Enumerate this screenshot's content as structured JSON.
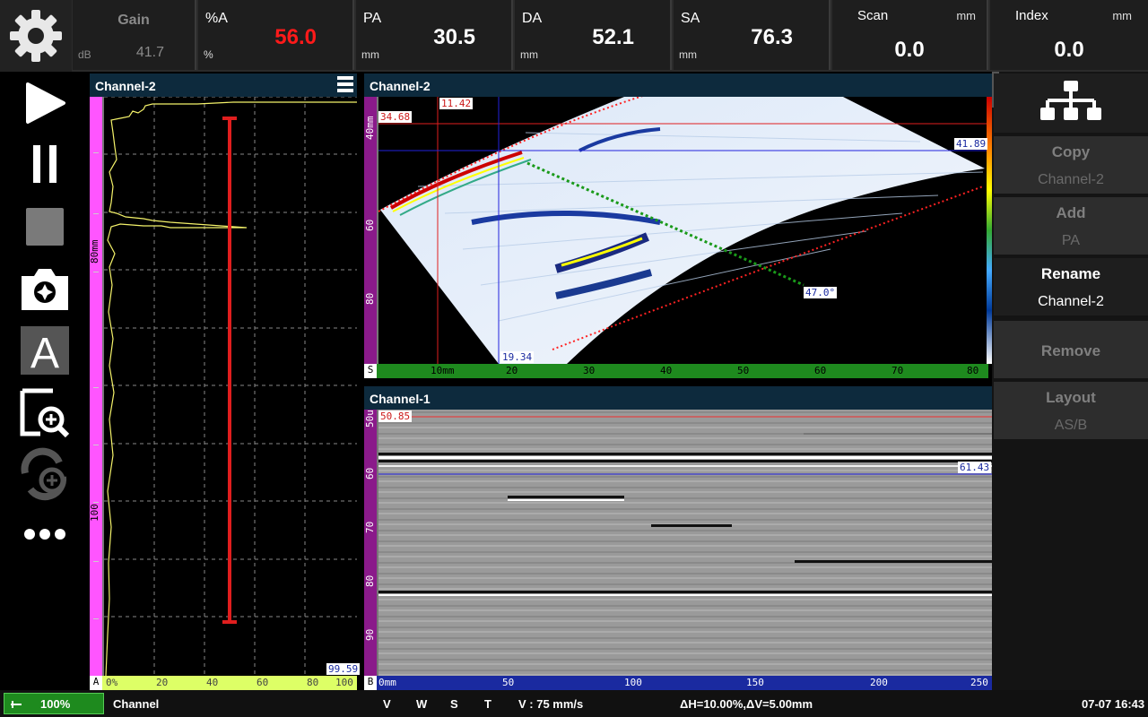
{
  "topbar": {
    "gain": {
      "label": "Gain",
      "unit": "dB",
      "value": "41.7"
    },
    "pct_a": {
      "label": "%A",
      "unit": "%",
      "value": "56.0"
    },
    "pa": {
      "label": "PA",
      "unit": "mm",
      "value": "30.5"
    },
    "da": {
      "label": "DA",
      "unit": "mm",
      "value": "52.1"
    },
    "sa": {
      "label": "SA",
      "unit": "mm",
      "value": "76.3"
    },
    "scan": {
      "label": "Scan",
      "unit": "mm",
      "value": "0.0"
    },
    "index": {
      "label": "Index",
      "unit": "mm",
      "value": "0.0"
    }
  },
  "left_tools": [
    "gear-icon",
    "play-icon",
    "pause-icon",
    "stop-icon",
    "camera-icon",
    "text-annotation-icon",
    "zoom-icon",
    "rotate-zoom-icon",
    "more-icon"
  ],
  "ascan": {
    "title": "Channel-2",
    "ruler_letter": "A",
    "depth_labels": [
      "80mm",
      "100"
    ],
    "x_ticks": [
      "0%",
      "20",
      "40",
      "60",
      "80",
      "100"
    ],
    "cursor_value": "99.59"
  },
  "sscan": {
    "title": "Channel-2",
    "ruler_letter": "S",
    "depth_labels": [
      "40mm",
      "60",
      "80"
    ],
    "x_ticks": [
      "10mm",
      "20",
      "30",
      "40",
      "50",
      "60",
      "70",
      "80"
    ],
    "ref_h": "34.68",
    "ref_v": "11.42",
    "meas_h": "41.89",
    "meas_v": "19.34",
    "angle": "47.0°"
  },
  "bscan": {
    "title": "Channel-1",
    "ruler_letter": "B",
    "depth_labels": [
      "50us",
      "60",
      "70",
      "80",
      "90"
    ],
    "x_ticks": [
      "0mm",
      "50",
      "100",
      "150",
      "200",
      "250"
    ],
    "ref_h": "50.85",
    "meas_h": "61.43"
  },
  "right_menu": {
    "copy": {
      "label": "Copy",
      "sub": "Channel-2"
    },
    "add": {
      "label": "Add",
      "sub": "PA"
    },
    "rename": {
      "label": "Rename",
      "sub": "Channel-2"
    },
    "remove": {
      "label": "Remove"
    },
    "layout": {
      "label": "Layout",
      "sub": "AS/B"
    }
  },
  "statusbar": {
    "battery": "100%",
    "channel": "Channel",
    "v": "V",
    "w": "W",
    "s": "S",
    "t": "T",
    "velocity": "V : 75 mm/s",
    "delta": "ΔH=10.00%,ΔV=5.00mm",
    "datetime": "07-07 16:43"
  },
  "colors": {
    "accent_red": "#ff1a1a",
    "magenta": "#ff55ff",
    "ruler_yellow": "#ddff66",
    "ruler_green": "#1e8a1e",
    "ruler_blue": "#1a2aa0"
  }
}
